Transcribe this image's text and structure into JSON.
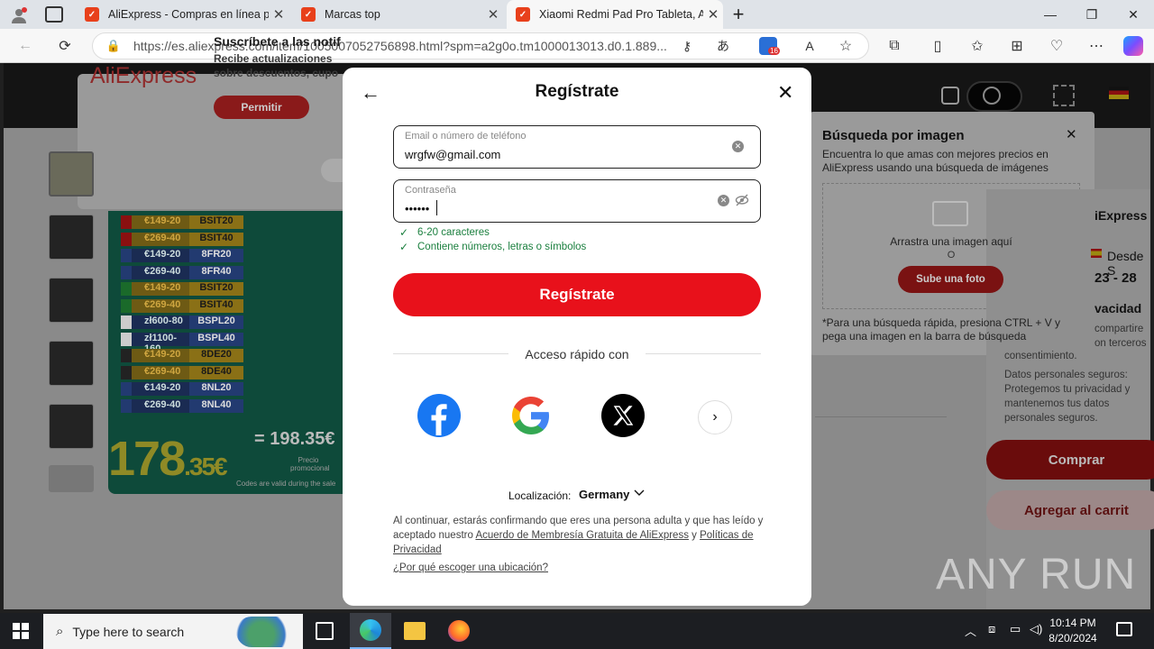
{
  "browser": {
    "tabs": [
      {
        "title": "AliExpress - Compras en línea pa",
        "active": false
      },
      {
        "title": "Marcas top",
        "active": false
      },
      {
        "title": "Xiaomi Redmi Pad Pro Tableta, A",
        "active": true
      }
    ],
    "url": "https://es.aliexpress.com/item/1005007052756898.html?spm=a2g0o.tm1000013013.d0.1.889...",
    "new_tab": "+",
    "badge_count": "16"
  },
  "page": {
    "subscribe": {
      "logo": "AliExpress",
      "title": "Suscríbete a las notif",
      "desc1": "Recibe actualizaciones",
      "desc2": "sobre descuentos, cupo",
      "allow": "Permitir"
    },
    "banner": {
      "codes": [
        {
          "amt": "€149-20",
          "code": "BSIT20",
          "flag": "es"
        },
        {
          "amt": "€269-40",
          "code": "BSIT40",
          "flag": "es"
        },
        {
          "amt": "€149-20",
          "code": "8FR20",
          "flag": "fr"
        },
        {
          "amt": "€269-40",
          "code": "8FR40",
          "flag": "fr"
        },
        {
          "amt": "€149-20",
          "code": "BSIT20",
          "flag": "it"
        },
        {
          "amt": "€269-40",
          "code": "BSIT40",
          "flag": "it"
        },
        {
          "amt": "zł600-80",
          "code": "BSPL20",
          "flag": "pl"
        },
        {
          "amt": "zł1100-160",
          "code": "BSPL40",
          "flag": "pl"
        },
        {
          "amt": "€149-20",
          "code": "8DE20",
          "flag": "de"
        },
        {
          "amt": "€269-40",
          "code": "8DE40",
          "flag": "de"
        },
        {
          "amt": "€149-20",
          "code": "8NL20",
          "flag": "nl"
        },
        {
          "amt": "€269-40",
          "code": "8NL40",
          "flag": "nl"
        }
      ],
      "price_int": "178",
      "price_dec": ".35€",
      "price_small": "= 198.35€",
      "promo": "Precio promocional",
      "footer": "Codes are valid during the sale"
    },
    "image_search": {
      "title": "Búsqueda por imagen",
      "desc": "Encuentra lo que amas con mejores precios en AliExpress usando una búsqueda de imágenes",
      "drag": "Arrastra una imagen aquí",
      "or": "O",
      "upload": "Sube una foto",
      "note": "*Para una búsqueda rápida, presiona CTRL + V y pega una imagen en la barra de búsqueda"
    },
    "right": {
      "store": "iExpress",
      "ship": "Desde S",
      "dates": "23 - 28",
      "privacy": "vacidad",
      "privacy_t1": "compartire",
      "privacy_t2": "on terceros",
      "privacy_t3": "consentimiento.",
      "secure": "Datos personales seguros: Protegemos tu privacidad y mantenemos tus datos personales seguros.",
      "buy": "Comprar",
      "cart": "Agregar al carrit"
    }
  },
  "modal": {
    "title": "Regístrate",
    "email_label": "Email o número de teléfono",
    "email_value": "wrgfw@gmail.com",
    "password_label": "Contraseña",
    "password_value": "••••••",
    "rule1": "6-20 caracteres",
    "rule2": "Contiene números, letras o símbolos",
    "submit": "Regístrate",
    "quick_access": "Acceso rápido con",
    "location_label": "Localización:",
    "location_value": "Germany",
    "terms_pre": "Al continuar, estarás confirmando que eres una persona adulta y que has leído y aceptado nuestro ",
    "terms_link1": "Acuerdo de Membresía Gratuita de AliExpress",
    "terms_mid": " y ",
    "terms_link2": "Políticas de Privacidad",
    "why": "¿Por qué escoger una ubicación?"
  },
  "watermark": "ANY RUN",
  "taskbar": {
    "search_placeholder": "Type here to search",
    "time": "10:14 PM",
    "date": "8/20/2024"
  },
  "colors": {
    "accent": "#e8111b",
    "check_green": "#1a7f3e"
  }
}
